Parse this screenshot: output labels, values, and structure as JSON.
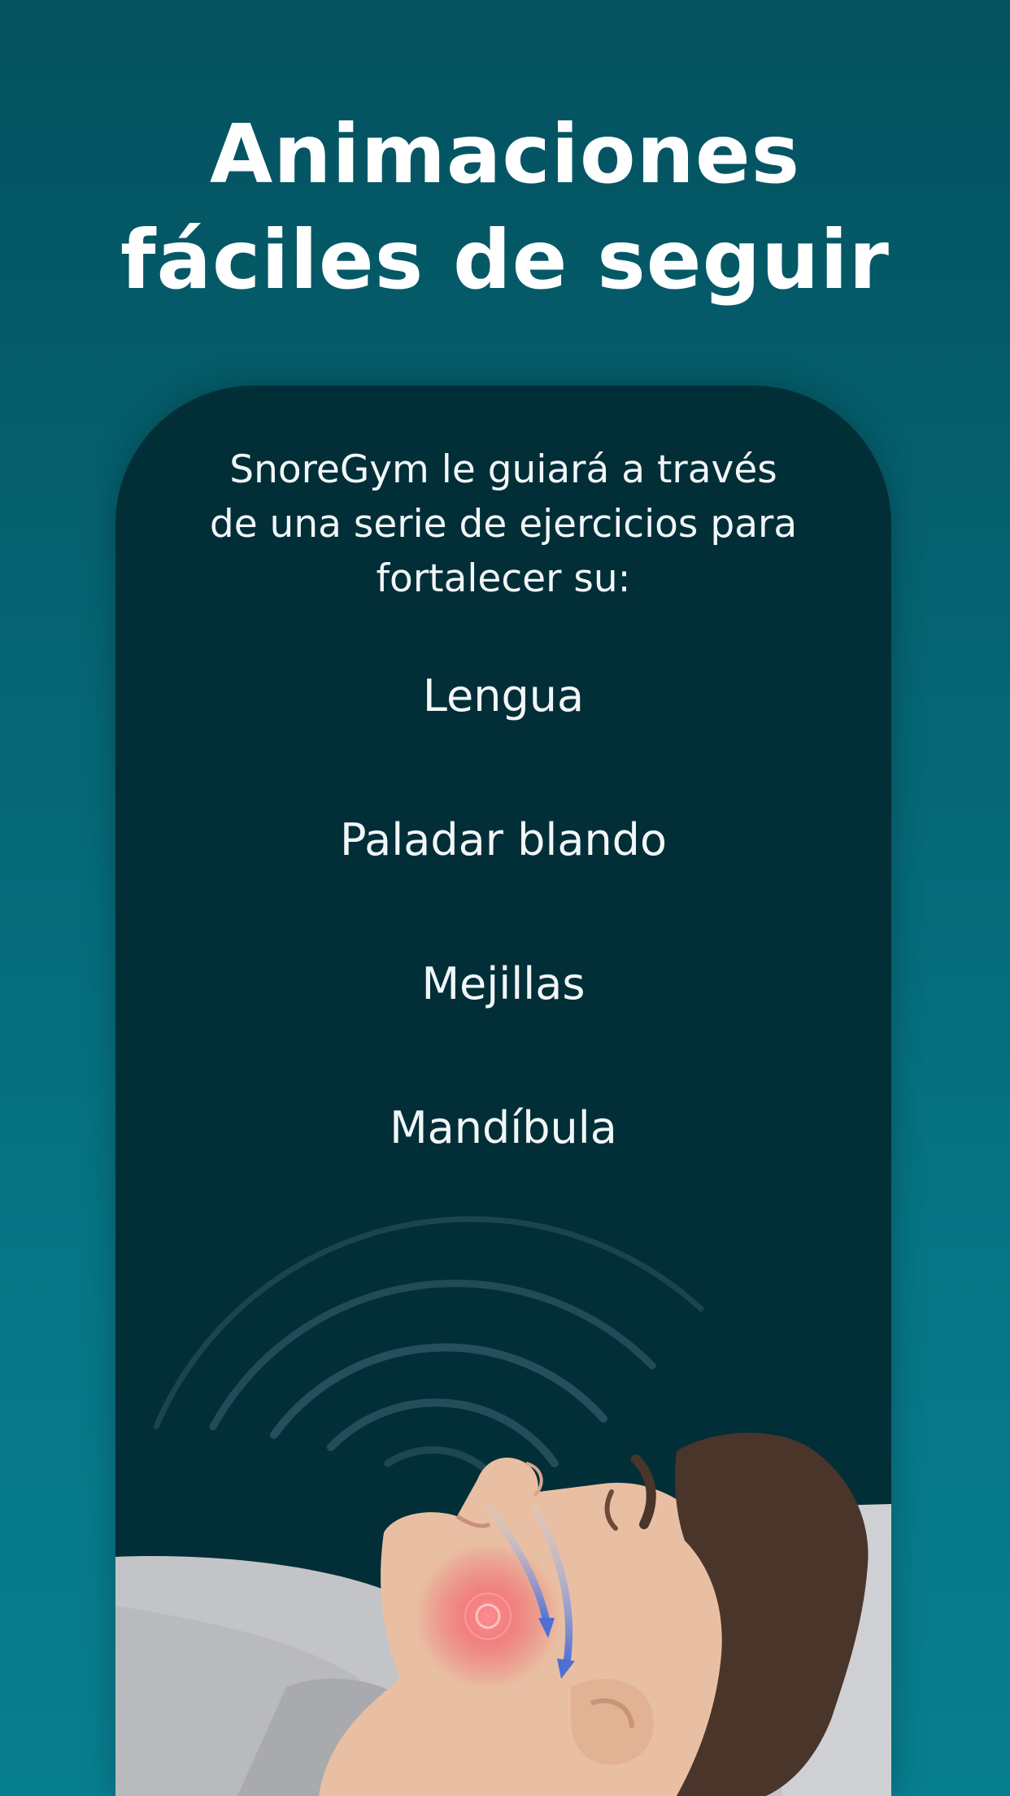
{
  "headline": {
    "line1": "Animaciones",
    "line2": "fáciles de seguir"
  },
  "card": {
    "intro_lines": [
      "SnoreGym le guiará a través",
      "de una serie de ejercicios para",
      "fortalecer su:"
    ],
    "muscles": [
      "Lengua",
      "Paladar blando",
      "Mejillas",
      "Mandíbula"
    ]
  },
  "illustration": {
    "subject": "sleeping-man-snoring",
    "colors": {
      "skin": "#e9bfa3",
      "hair": "#4a352b",
      "pillow": "#c9c9cb",
      "highlight": "#f05a63",
      "arrows": "#5b7fd8"
    }
  }
}
